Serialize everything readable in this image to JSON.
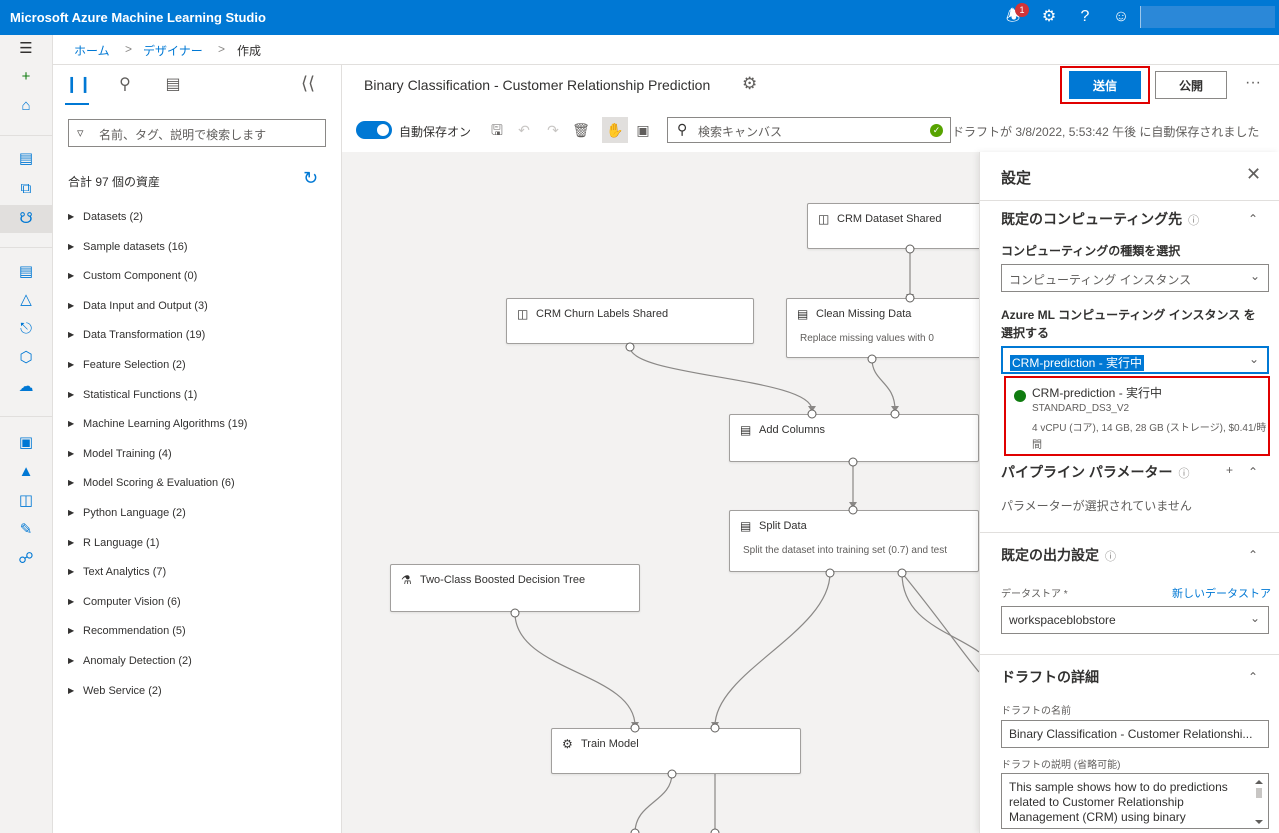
{
  "app_title": "Microsoft Azure Machine Learning Studio",
  "topbar": {
    "notification_count": "1",
    "icons": [
      "bell-icon",
      "gear-icon",
      "help-icon",
      "smiley-icon"
    ]
  },
  "breadcrumb": [
    "ホーム",
    "デザイナー",
    "作成"
  ],
  "assets": {
    "search_placeholder": "名前、タグ、説明で検索します",
    "count_label": "合計 97 個の資産",
    "categories": [
      "Datasets (2)",
      "Sample datasets (16)",
      "Custom Component (0)",
      "Data Input and Output (3)",
      "Data Transformation (19)",
      "Feature Selection (2)",
      "Statistical Functions (1)",
      "Machine Learning Algorithms (19)",
      "Model Training (4)",
      "Model Scoring & Evaluation (6)",
      "Python Language (2)",
      "R Language (1)",
      "Text Analytics (7)",
      "Computer Vision (6)",
      "Recommendation (5)",
      "Anomaly Detection (2)",
      "Web Service (2)"
    ]
  },
  "header": {
    "pipeline_title": "Binary Classification - Customer Relationship Prediction",
    "submit_label": "送信",
    "publish_label": "公開",
    "more_label": "···"
  },
  "toolbar": {
    "autosave_label": "自動保存オン",
    "autosave_on": true,
    "search_placeholder": "検索キャンバス",
    "draft_status": "ドラフトが 3/8/2022, 5:53:42 午後 に自動保存されました"
  },
  "canvas": {
    "nodes": [
      {
        "id": "crm-dataset",
        "name": "CRM Dataset Shared",
        "desc": "",
        "icon": "dataset-icon"
      },
      {
        "id": "crm-churn",
        "name": "CRM Churn Labels Shared",
        "desc": "",
        "icon": "dataset-icon"
      },
      {
        "id": "clean-missing",
        "name": "Clean Missing Data",
        "desc": "Replace missing values with 0",
        "icon": "module-icon"
      },
      {
        "id": "add-columns",
        "name": "Add Columns",
        "desc": "",
        "icon": "module-icon"
      },
      {
        "id": "split-data",
        "name": "Split Data",
        "desc": "Split the dataset into training set (0.7) and test",
        "icon": "module-icon"
      },
      {
        "id": "two-class",
        "name": "Two-Class Boosted Decision Tree",
        "desc": "",
        "icon": "algorithm-icon"
      },
      {
        "id": "train-model",
        "name": "Train Model",
        "desc": "",
        "icon": "train-icon"
      }
    ]
  },
  "settings": {
    "title": "設定",
    "compute_section": {
      "heading": "既定のコンピューティング先",
      "type_label": "コンピューティングの種類を選択",
      "type_value": "コンピューティング インスタンス",
      "instance_label_1": "Azure ML コンピューティング インスタンス を",
      "instance_label_2": "選択する",
      "instance_value": "CRM-prediction - 実行中",
      "option": {
        "name": "CRM-prediction - 実行中",
        "sku": "STANDARD_DS3_V2",
        "spec": "4 vCPU (コア), 14 GB, 28 GB (ストレージ), $0.41/時間",
        "status_color": "#107c10"
      }
    },
    "params_section": {
      "heading": "パイプライン パラメーター",
      "empty_text": "パラメーターが選択されていません"
    },
    "output_section": {
      "heading": "既定の出力設定",
      "datastore_label": "データストア *",
      "new_datastore_link": "新しいデータストア",
      "datastore_value": "workspaceblobstore"
    },
    "draft_section": {
      "heading": "ドラフトの詳細",
      "name_label": "ドラフトの名前",
      "name_value": "Binary Classification - Customer Relationshi...",
      "desc_label": "ドラフトの説明 (省略可能)",
      "desc_value": "This sample shows how to do predictions related to Customer Relationship Management (CRM) using binary"
    }
  },
  "colors": {
    "accent": "#0078d4",
    "highlight": "#e00000",
    "running": "#107c10"
  }
}
